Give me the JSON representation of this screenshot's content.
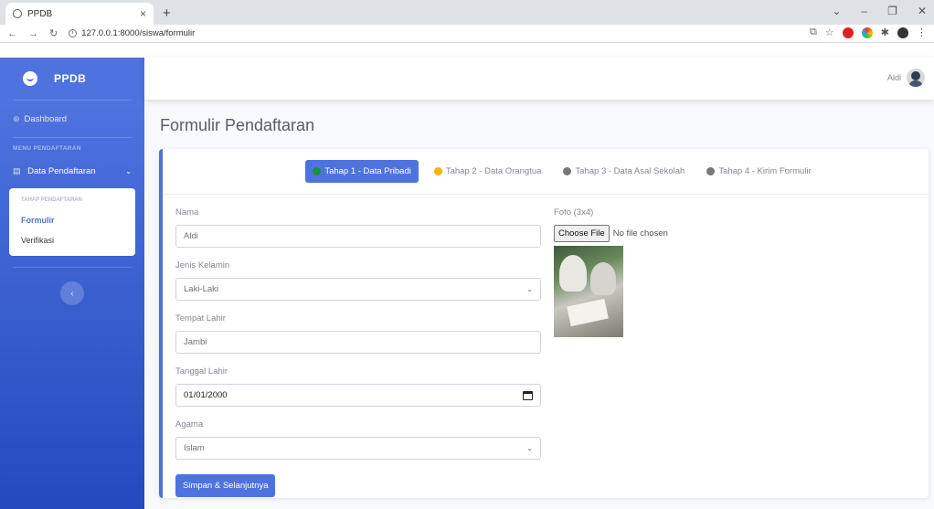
{
  "browser": {
    "tab_title": "PPDB",
    "tab_close": "×",
    "new_tab": "+",
    "url": "127.0.0.1:8000/siswa/formulir",
    "controls": [
      "⌄",
      "–",
      "❐",
      "✕"
    ]
  },
  "sidebar": {
    "brand": "PPDB",
    "dashboard": "Dashboard",
    "section_heading": "MENU PENDAFTARAN",
    "data_pendaftaran": "Data Pendaftaran",
    "submenu_heading": "TAHAP PENDAFTARAN",
    "submenu_items": [
      "Formulir",
      "Verifikasi"
    ],
    "toggle_icon": "‹"
  },
  "topbar": {
    "user_name": "Aldi"
  },
  "page": {
    "title": "Formulir Pendaftaran",
    "steps": [
      {
        "label": "Tahap 1 - Data Pribadi",
        "color": "#1e8e3e"
      },
      {
        "label": "Tahap 2 - Data Orangtua",
        "color": "#f6b400"
      },
      {
        "label": "Tahap 3 - Data Asal Sekolah",
        "color": "#777777"
      },
      {
        "label": "Tahap 4 - Kirim Formulir",
        "color": "#777777"
      }
    ],
    "form": {
      "nama_label": "Nama",
      "nama_value": "Aldi",
      "jk_label": "Jenis Kelamin",
      "jk_value": "Laki-Laki",
      "tempat_label": "Tempat Lahir",
      "tempat_value": "Jambi",
      "tanggal_label": "Tanggal Lahir",
      "tanggal_value": "01/01/2000",
      "agama_label": "Agama",
      "agama_value": "Islam",
      "submit": "Simpan & Selanjutnya"
    },
    "photo": {
      "label": "Foto (3x4)",
      "choose_file": "Choose File",
      "no_file": "No file chosen"
    }
  },
  "colors": {
    "primary": "#4e73df"
  }
}
